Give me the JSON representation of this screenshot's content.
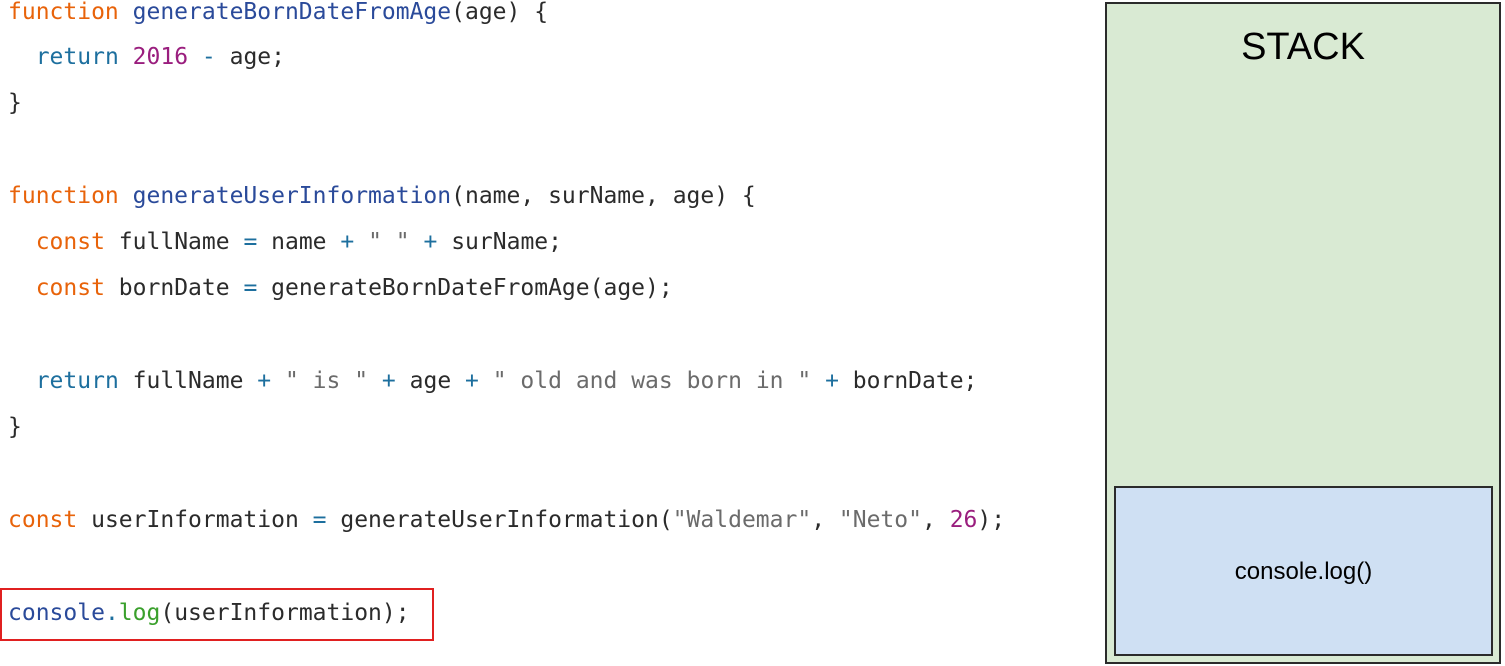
{
  "code_lines": {
    "l1": {
      "kw": "function",
      "sp": " ",
      "fn": "generateBornDateFromAge",
      "rest": "(age) {"
    },
    "l2": {
      "indent": "  ",
      "ret": "return",
      "sp": " ",
      "num": "2016",
      "op": " - ",
      "rest": "age;"
    },
    "l3": {
      "text": "}"
    },
    "l4": {
      "kw": "function",
      "sp": " ",
      "fn": "generateUserInformation",
      "rest": "(name, surName, age) {"
    },
    "l5": {
      "indent": "  ",
      "kw": "const",
      "a": " fullName ",
      "op1": "=",
      "b": " name ",
      "op2": "+",
      "str": " \" \" ",
      "op3": "+",
      "c": " surName;"
    },
    "l6": {
      "indent": "  ",
      "kw": "const",
      "a": " bornDate ",
      "op1": "=",
      "b": " generateBornDateFromAge(age);"
    },
    "l7": {
      "indent": "  ",
      "ret": "return",
      "a": " fullName ",
      "op1": "+",
      "str1": " \" is \" ",
      "op2": "+",
      "b": " age ",
      "op3": "+",
      "str2": " \" old and was born in \" ",
      "op4": "+",
      "c": " bornDate;"
    },
    "l8": {
      "text": "}"
    },
    "l9": {
      "kw": "const",
      "a": " userInformation ",
      "op1": "=",
      "b": " generateUserInformation(",
      "str1": "\"Waldemar\"",
      "c": ", ",
      "str2": "\"Neto\"",
      "d": ", ",
      "num": "26",
      "e": ");"
    },
    "l10": {
      "obj": "console",
      "dot": ".",
      "meth": "log",
      "rest": "(userInformation);"
    }
  },
  "stack": {
    "title": "STACK",
    "frames": [
      "console.log()"
    ]
  },
  "colors": {
    "keyword": "#e8630a",
    "function_name": "#2a4a9a",
    "return_keyword": "#1d6f9e",
    "number": "#9a1e7e",
    "string": "#6b6b6b",
    "method": "#3aa02c",
    "highlight_border": "#e02020",
    "stack_background": "#d9ead3",
    "frame_background": "#cfe0f3"
  }
}
